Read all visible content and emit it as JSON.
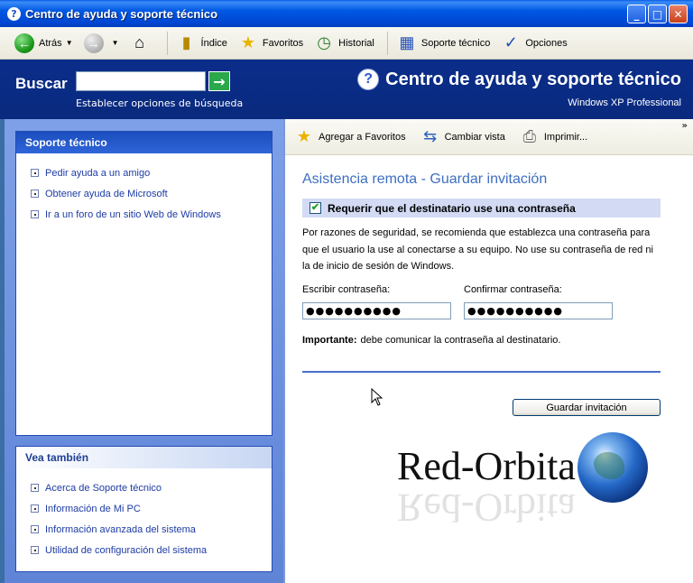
{
  "window": {
    "title": "Centro de ayuda y soporte técnico"
  },
  "toolbar": {
    "back": "Atrás",
    "index": "Índice",
    "favorites": "Favoritos",
    "history": "Historial",
    "support": "Soporte técnico",
    "options": "Opciones"
  },
  "header": {
    "search_label": "Buscar",
    "search_value": "",
    "search_options": "Establecer opciones de búsqueda",
    "app_title": "Centro de ayuda y soporte técnico",
    "edition": "Windows XP Professional"
  },
  "left": {
    "support_box": {
      "title": "Soporte técnico",
      "items": [
        "Pedir ayuda a un amigo",
        "Obtener ayuda de Microsoft",
        "Ir a un foro de un sitio Web de Windows"
      ]
    },
    "see_also_box": {
      "title": "Vea también",
      "items": [
        "Acerca de Soporte técnico",
        "Información de Mi PC",
        "Información avanzada del sistema",
        "Utilidad de configuración del sistema"
      ]
    }
  },
  "right_toolbar": {
    "add_favorites": "Agregar a Favoritos",
    "change_view": "Cambiar vista",
    "print": "Imprimir...",
    "more": "»"
  },
  "content": {
    "heading": "Asistencia remota - Guardar invitación",
    "require_password": "Requerir que el destinatario use una contraseña",
    "require_checked": true,
    "paragraph": "Por razones de seguridad, se recomienda que establezca una contraseña para que el usuario la use al conectarse a su equipo. No use su contraseña de red ni la de inicio de sesión de Windows.",
    "password_label": "Escribir contraseña:",
    "password_value": "●●●●●●●●●●",
    "confirm_label": "Confirmar contraseña:",
    "confirm_value": "●●●●●●●●●●",
    "important_label": "Importante:",
    "important_text": "debe comunicar la contraseña al destinatario.",
    "save_button": "Guardar invitación"
  },
  "watermark": {
    "text": "Red-Orbita"
  },
  "colors": {
    "title_bar": "#0058e3",
    "band": "#0a2e87",
    "left_panel": "#6b8fdd",
    "heading": "#3e6fc0",
    "link": "#1c3ba6"
  }
}
